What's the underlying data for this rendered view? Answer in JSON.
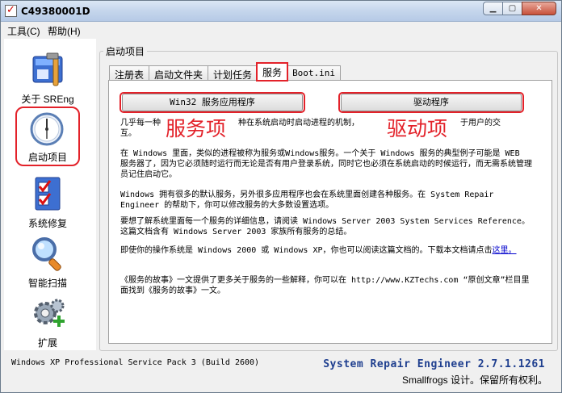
{
  "window": {
    "title": "C49380001D",
    "controls": [
      "minimize",
      "maximize",
      "close"
    ]
  },
  "menu": [
    {
      "label": "工具(C)"
    },
    {
      "label": "帮助(H)"
    }
  ],
  "sidebar": {
    "items": [
      {
        "label": "关于 SREng",
        "icon": "toolbox-icon"
      },
      {
        "label": "启动项目",
        "icon": "clock-icon",
        "highlighted": true
      },
      {
        "label": "系统修复",
        "icon": "checklist-icon"
      },
      {
        "label": "智能扫描",
        "icon": "magnifier-icon"
      },
      {
        "label": "扩展",
        "icon": "gears-icon"
      }
    ]
  },
  "main": {
    "group_title": "启动项目",
    "tabs": [
      {
        "label": "注册表"
      },
      {
        "label": "启动文件夹"
      },
      {
        "label": "计划任务"
      },
      {
        "label": "服务",
        "active": true
      },
      {
        "label": "Boot.ini"
      }
    ],
    "buttons": {
      "win32": "Win32 服务应用程序",
      "driver": "驱动程序"
    },
    "annotations": {
      "service": "服务项",
      "driver": "驱动项"
    },
    "paragraphs": {
      "p1a": "几乎每一种",
      "p1b": "种在系统启动时启动进程的机制，",
      "p1c": "于用户的交",
      "p1d": "互。",
      "p2": "在 Windows 里面，类似的进程被称为服务或Windows服务。一个关于 Windows 服务的典型例子可能是 WEB 服务器了，因为它必须随时运行而无论是否有用户登录系统，同时它也必须在系统启动的时候运行，而无需系统管理员记住启动它。",
      "p3": "Windows 拥有很多的默认服务，另外很多应用程序也会在系统里面创建各种服务。在 System Repair Engineer 的帮助下，你可以修改服务的大多数设置选项。",
      "p4": "要想了解系统里面每一个服务的详细信息，请阅读 Windows Server 2003 System Services Reference。这篇文档含有 Windows Server 2003 家族所有服务的总结。",
      "p5a": "即使你的操作系统是 Windows 2000 或 Windows XP，你也可以阅读这篇文档的。下载本文档请点击",
      "p5_link": "这里。",
      "p6": "《服务的故事》一文提供了更多关于服务的一些解释，你可以在 http://www.KZTechs.com “原创文章”栏目里面找到《服务的故事》一文。"
    }
  },
  "status": {
    "os": "Windows XP Professional Service Pack 3 (Build 2600)",
    "product": "System Repair Engineer 2.7.1.1261",
    "copyright": "Smallfrogs 设计。保留所有权利。"
  }
}
